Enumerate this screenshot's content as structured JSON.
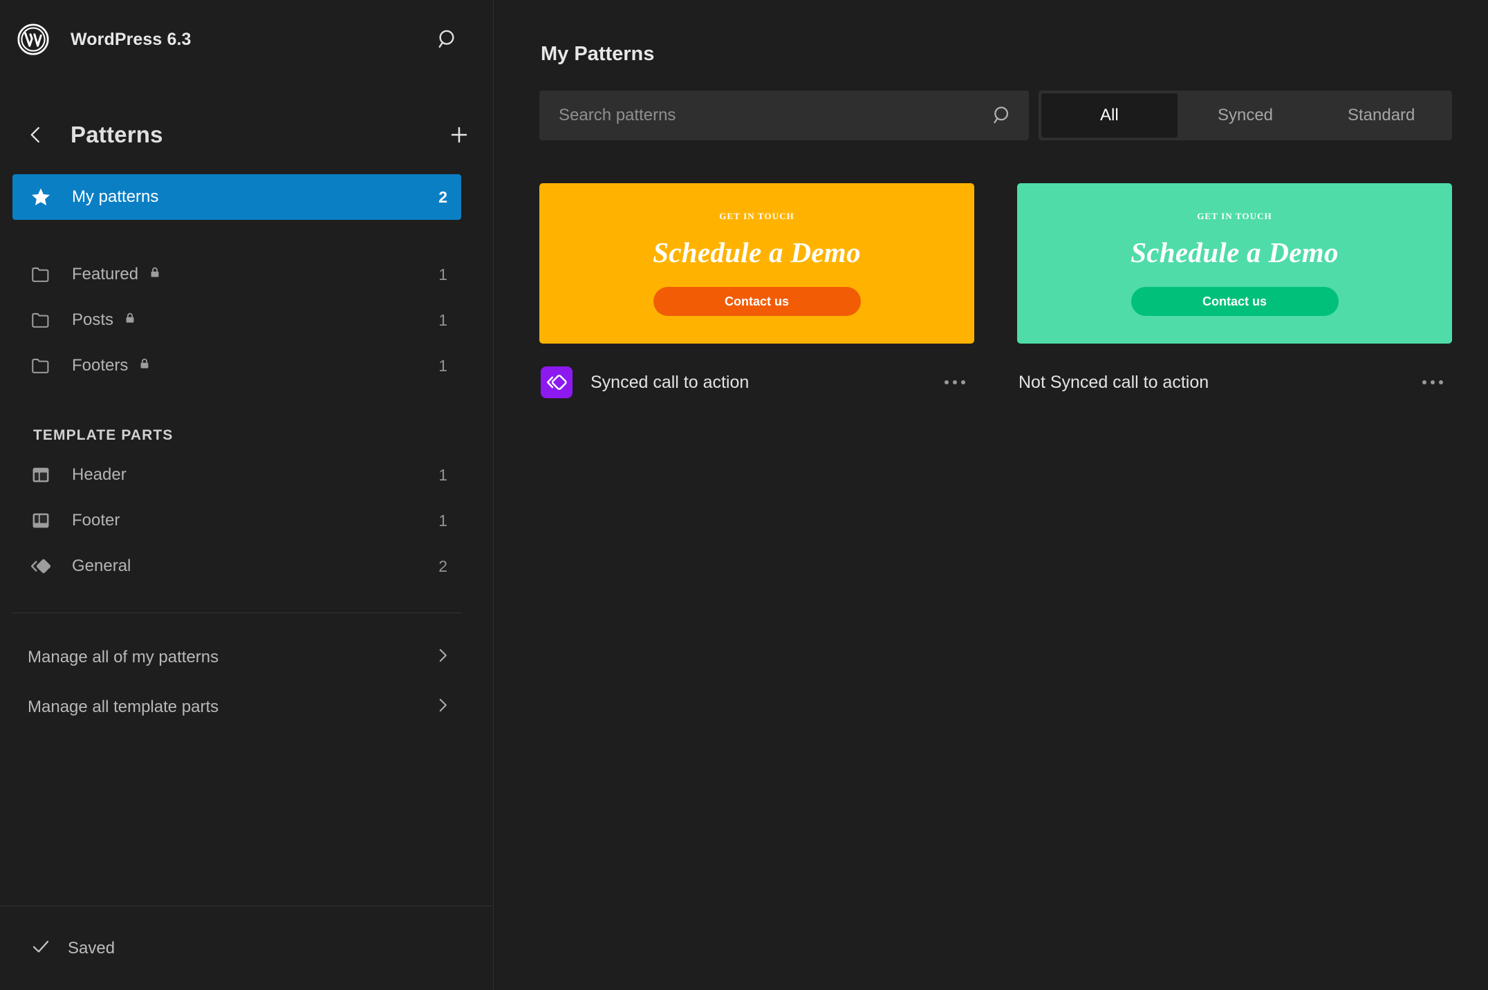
{
  "colors": {
    "app_bg": "#1e1e1e",
    "sidebar_bg": "#1e1e1e",
    "active_blue": "#0b7fc4",
    "field_bg": "#2f2f2f",
    "segment_selected_bg": "#1b1b1b",
    "sync_badge_purple": "#8c19ef",
    "card1_bg": "#ffb300",
    "card1_button": "#f25c05",
    "card2_bg": "#4fdca8",
    "card2_button": "#00c07a"
  },
  "site_header": {
    "logo_icon": "wordpress-logo-icon",
    "title": "WordPress 6.3",
    "search_icon": "search-icon"
  },
  "sidebar": {
    "back_icon": "chevron-left-icon",
    "title": "Patterns",
    "add_icon": "plus-icon",
    "my_patterns": {
      "icon": "star-icon",
      "label": "My patterns",
      "count": "2"
    },
    "categories": [
      {
        "icon": "folder-icon",
        "label": "Featured",
        "locked": true,
        "lock_icon": "lock-icon",
        "count": "1"
      },
      {
        "icon": "folder-icon",
        "label": "Posts",
        "locked": true,
        "lock_icon": "lock-icon",
        "count": "1"
      },
      {
        "icon": "folder-icon",
        "label": "Footers",
        "locked": true,
        "lock_icon": "lock-icon",
        "count": "1"
      }
    ],
    "template_parts_label": "TEMPLATE PARTS",
    "template_parts": [
      {
        "icon": "layout-header-icon",
        "label": "Header",
        "count": "1"
      },
      {
        "icon": "layout-footer-icon",
        "label": "Footer",
        "count": "1"
      },
      {
        "icon": "layout-general-icon",
        "label": "General",
        "count": "2"
      }
    ],
    "manage_links": [
      {
        "label": "Manage all of my patterns",
        "chevron": "chevron-right-icon"
      },
      {
        "label": "Manage all template parts",
        "chevron": "chevron-right-icon"
      }
    ],
    "save_status": {
      "icon": "check-icon",
      "label": "Saved"
    }
  },
  "main": {
    "title": "My Patterns",
    "search": {
      "placeholder": "Search patterns",
      "value": "",
      "icon": "search-icon"
    },
    "filters": [
      {
        "label": "All",
        "selected": true
      },
      {
        "label": "Synced",
        "selected": false
      },
      {
        "label": "Standard",
        "selected": false
      }
    ],
    "patterns": [
      {
        "name": "Synced call to action",
        "synced": true,
        "badge_icon": "synced-pattern-icon",
        "menu_icon": "ellipsis-icon",
        "preview": {
          "eyebrow": "GET IN TOUCH",
          "headline": "Schedule a Demo",
          "button": "Contact us",
          "bg": "#ffb300",
          "button_bg": "#f25c05"
        }
      },
      {
        "name": "Not Synced call to action",
        "synced": false,
        "menu_icon": "ellipsis-icon",
        "preview": {
          "eyebrow": "GET IN TOUCH",
          "headline": "Schedule a Demo",
          "button": "Contact us",
          "bg": "#4fdca8",
          "button_bg": "#00c07a"
        }
      }
    ]
  }
}
